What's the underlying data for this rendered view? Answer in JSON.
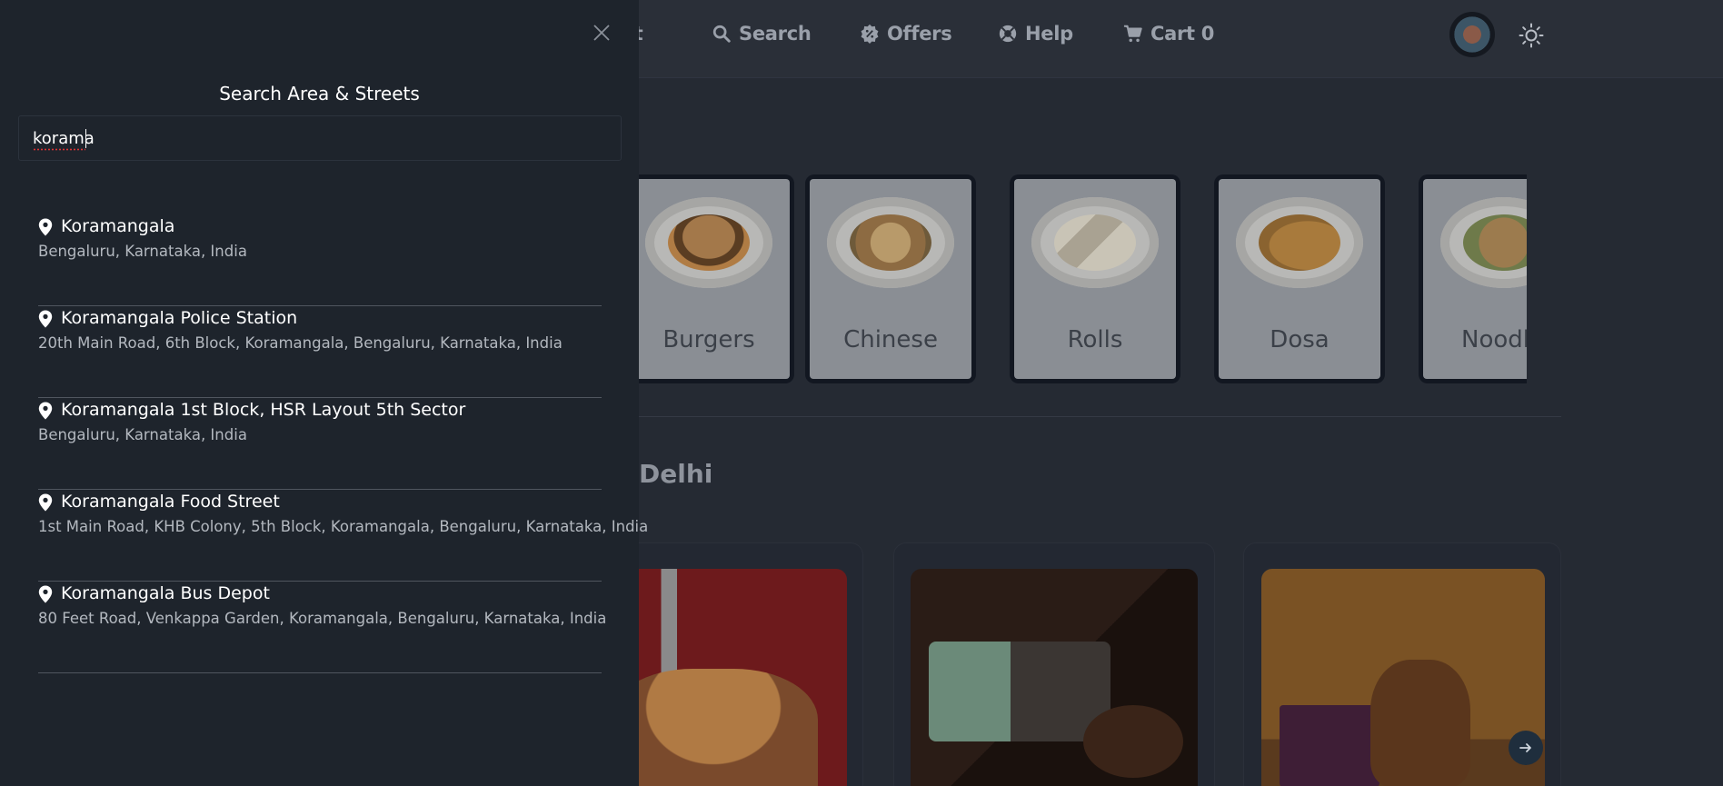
{
  "nav": {
    "partial_item": "ut",
    "search": "Search",
    "offers": "Offers",
    "help": "Help",
    "cart": "Cart 0"
  },
  "categories": [
    {
      "name": "Burgers"
    },
    {
      "name": "Chinese"
    },
    {
      "name": "Rolls"
    },
    {
      "name": "Dosa"
    },
    {
      "name": "Noodl"
    }
  ],
  "section": {
    "title_partial": "Delhi"
  },
  "panel": {
    "title": "Search Area & Streets",
    "search_value": "korama",
    "results": [
      {
        "title": "Koramangala",
        "subtitle": "Bengaluru, Karnataka, India"
      },
      {
        "title": "Koramangala Police Station",
        "subtitle": "20th Main Road, 6th Block, Koramangala, Bengaluru, Karnataka, India"
      },
      {
        "title": "Koramangala 1st Block, HSR Layout 5th Sector",
        "subtitle": "Bengaluru, Karnataka, India"
      },
      {
        "title": "Koramangala Food Street",
        "subtitle": "1st Main Road, KHB Colony, 5th Block, Koramangala, Bengaluru, Karnataka, India"
      },
      {
        "title": "Koramangala Bus Depot",
        "subtitle": "80 Feet Road, Venkappa Garden, Koramangala, Bengaluru, Karnataka, India"
      }
    ]
  },
  "colors": {
    "panel_bg": "#1e242c",
    "overlay_page_bg": "#252a33"
  },
  "icons": {
    "close": "close-icon",
    "pin": "location-pin-icon",
    "search": "search-icon",
    "offers": "offers-badge-icon",
    "help": "help-lifebuoy-icon",
    "cart": "cart-icon",
    "theme": "sun-icon",
    "next": "arrow-right-icon"
  }
}
